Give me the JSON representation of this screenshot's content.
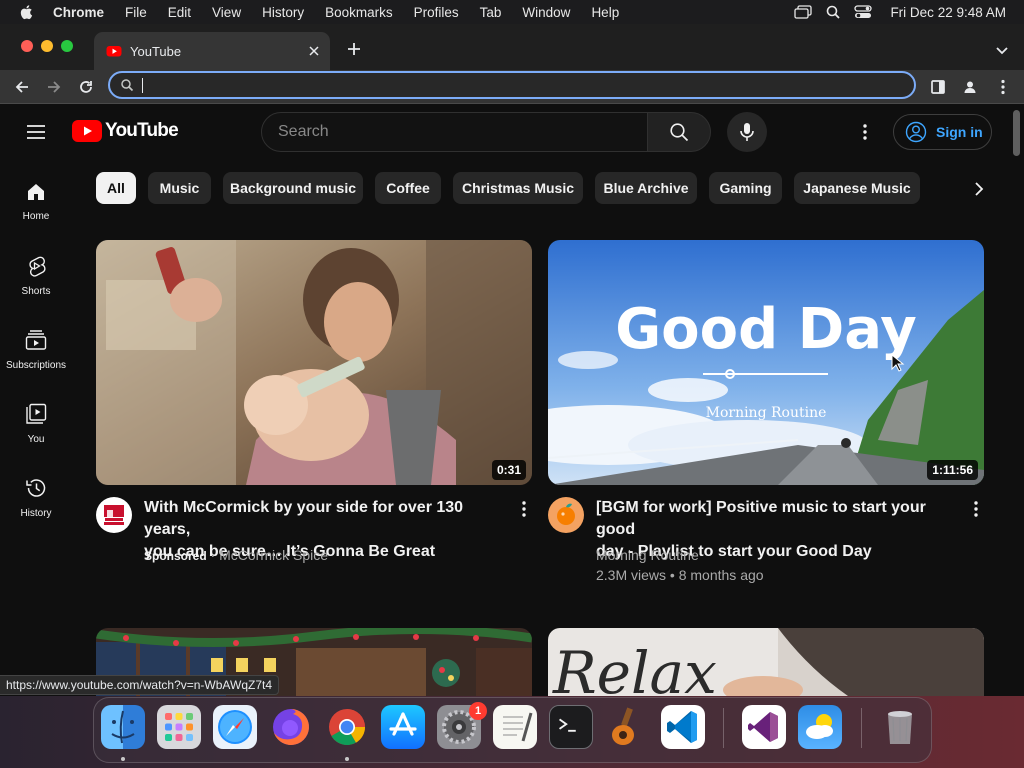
{
  "menubar": {
    "app": "Chrome",
    "items": [
      "File",
      "Edit",
      "View",
      "History",
      "Bookmarks",
      "Profiles",
      "Tab",
      "Window",
      "Help"
    ],
    "clock": "Fri Dec 22  9:48 AM"
  },
  "browser": {
    "tab_title": "YouTube",
    "omnibox_value": "",
    "status_url": "https://www.youtube.com/watch?v=n-WbAWqZ7t4"
  },
  "youtube": {
    "logo_text": "YouTube",
    "search_placeholder": "Search",
    "signin_label": "Sign in",
    "chips": [
      "All",
      "Music",
      "Background music",
      "Coffee",
      "Christmas Music",
      "Blue Archive",
      "Gaming",
      "Japanese Music"
    ],
    "nav": [
      "Home",
      "Shorts",
      "Subscriptions",
      "You",
      "History"
    ],
    "videos": [
      {
        "title_line1": "With McCormick by your side for over 130 years,",
        "title_line2": "you can be sure… It’s Gonna Be Great",
        "duration": "0:31",
        "sponsored": "Sponsored",
        "channel": "McCormick Spice",
        "views": "",
        "age": ""
      },
      {
        "title_line1": "[BGM for work] Positive music to start your good",
        "title_line2": "day - Playlist to start your Good Day",
        "duration": "1:11:56",
        "channel": "Morning Routine",
        "views": "2.3M views",
        "age": "8 months ago",
        "thumb_text": "Good Day",
        "thumb_sub": "Morning Routine"
      }
    ],
    "lower_thumb_text": "Relax"
  },
  "dock": {
    "apps": [
      "finder-icon",
      "launchpad-icon",
      "safari-icon",
      "firefox-icon",
      "chrome-icon",
      "app-store-icon",
      "system-settings-icon",
      "textedit-icon",
      "terminal-icon",
      "garageband-icon",
      "vscode-icon",
      "visual-studio-icon",
      "weather-icon",
      "trash-icon"
    ],
    "settings_badge": "1"
  },
  "colors": {
    "accent_blue": "#3ea6ff",
    "youtube_red": "#ff0000",
    "background": "#0f0f0f"
  }
}
